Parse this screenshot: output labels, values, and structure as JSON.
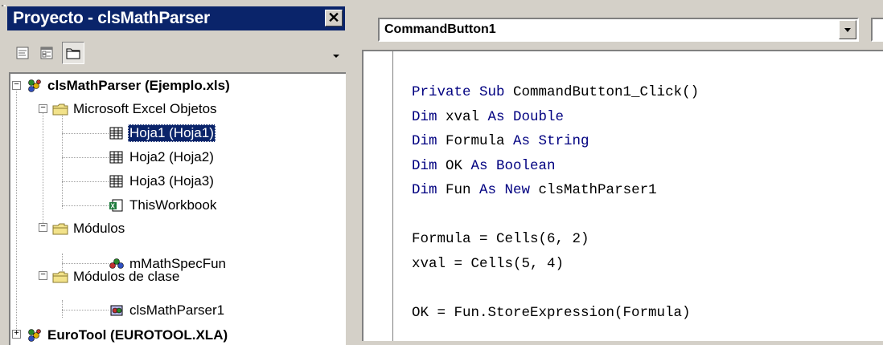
{
  "project_explorer": {
    "title": "Proyecto - clsMathParser",
    "close_glyph": "✕",
    "toolbar": [
      {
        "name": "view-code-icon"
      },
      {
        "name": "view-object-icon"
      },
      {
        "name": "toggle-folders-icon",
        "pressed": true
      }
    ],
    "tree": [
      {
        "label": "clsMathParser (Ejemplo.xls)",
        "bold": true,
        "icon": "vba-project-icon",
        "expander": "−"
      },
      {
        "label": "Microsoft Excel Objetos",
        "icon": "folder-icon",
        "expander": "−"
      },
      {
        "label": "Hoja1 (Hoja1)",
        "icon": "sheet-icon",
        "selected": true
      },
      {
        "label": "Hoja2 (Hoja2)",
        "icon": "sheet-icon"
      },
      {
        "label": "Hoja3 (Hoja3)",
        "icon": "sheet-icon"
      },
      {
        "label": "ThisWorkbook",
        "icon": "workbook-icon"
      },
      {
        "label": "Módulos",
        "icon": "folder-icon",
        "expander": "−"
      },
      {
        "label": "mMathSpecFun",
        "icon": "module-icon"
      },
      {
        "label": "Módulos de clase",
        "icon": "folder-icon",
        "expander": "−"
      },
      {
        "label": "clsMathParser1",
        "icon": "class-module-icon"
      },
      {
        "label": "EuroTool (EUROTOOL.XLA)",
        "bold": true,
        "icon": "vba-project-icon",
        "expander": "+"
      }
    ]
  },
  "code_window": {
    "object_combo": "CommandButton1",
    "code_lines": [
      [
        {
          "t": "Private Sub",
          "kw": true
        },
        {
          "t": " CommandButton1_Click()"
        }
      ],
      [
        {
          "t": "Dim",
          "kw": true
        },
        {
          "t": " xval "
        },
        {
          "t": "As Double",
          "kw": true
        }
      ],
      [
        {
          "t": "Dim",
          "kw": true
        },
        {
          "t": " Formula "
        },
        {
          "t": "As String",
          "kw": true
        }
      ],
      [
        {
          "t": "Dim",
          "kw": true
        },
        {
          "t": " OK "
        },
        {
          "t": "As Boolean",
          "kw": true
        }
      ],
      [
        {
          "t": "Dim",
          "kw": true
        },
        {
          "t": " Fun "
        },
        {
          "t": "As New",
          "kw": true
        },
        {
          "t": " clsMathParser1"
        }
      ],
      [],
      [
        {
          "t": "Formula = Cells(6, 2)"
        }
      ],
      [
        {
          "t": "xval = Cells(5, 4)"
        }
      ],
      [],
      [
        {
          "t": "OK = Fun.StoreExpression(Formula)"
        }
      ]
    ]
  },
  "colors": {
    "keyword": "#000080",
    "selection": "#0a246a",
    "titlebar": "#0a246a"
  }
}
